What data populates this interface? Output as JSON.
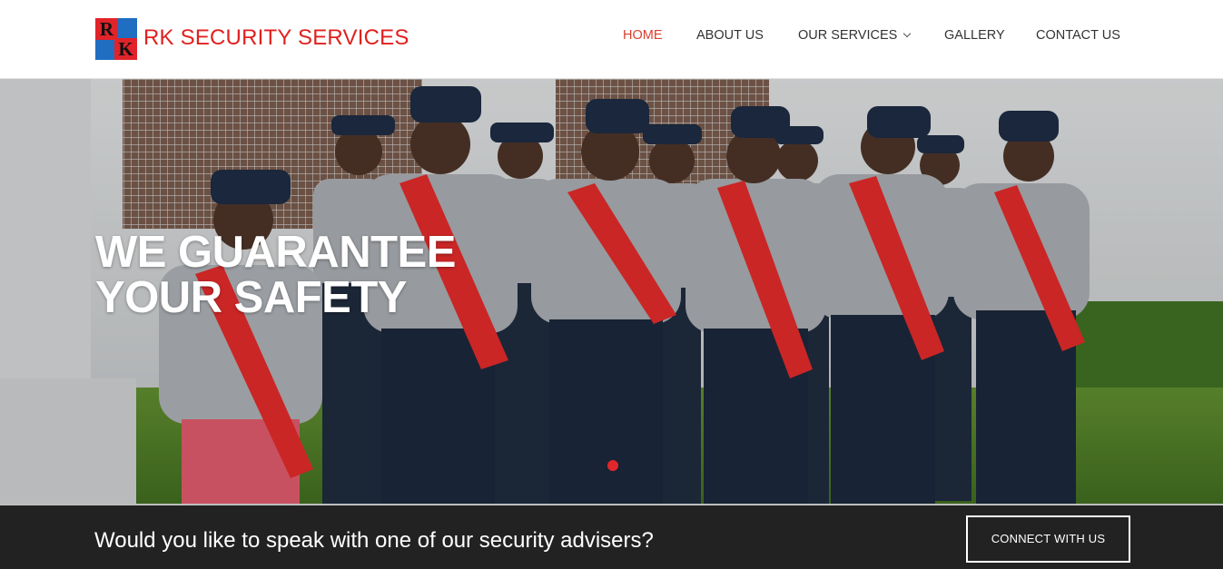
{
  "brand": {
    "letter_top": "R",
    "letter_bottom": "K",
    "name": "RK SECURITY SERVICES"
  },
  "nav": [
    {
      "label": "HOME",
      "active": true
    },
    {
      "label": "ABOUT US",
      "active": false
    },
    {
      "label": "OUR SERVICES",
      "active": false,
      "has_dropdown": true
    },
    {
      "label": "GALLERY",
      "active": false
    },
    {
      "label": "CONTACT US",
      "active": false
    }
  ],
  "hero": {
    "headline_line1": "WE GUARANTEE",
    "headline_line2": "YOUR SAFETY",
    "slider_dots": 1,
    "active_dot": 1
  },
  "cta": {
    "text": "Would you like to speak with one of our security advisers?",
    "button_label": "CONNECT WITH US"
  },
  "colors": {
    "brand_red": "#e0211f",
    "nav_active": "#d9412e",
    "nav_text": "#333333",
    "cta_bg": "#222222",
    "slider_dot": "#e0282a"
  }
}
